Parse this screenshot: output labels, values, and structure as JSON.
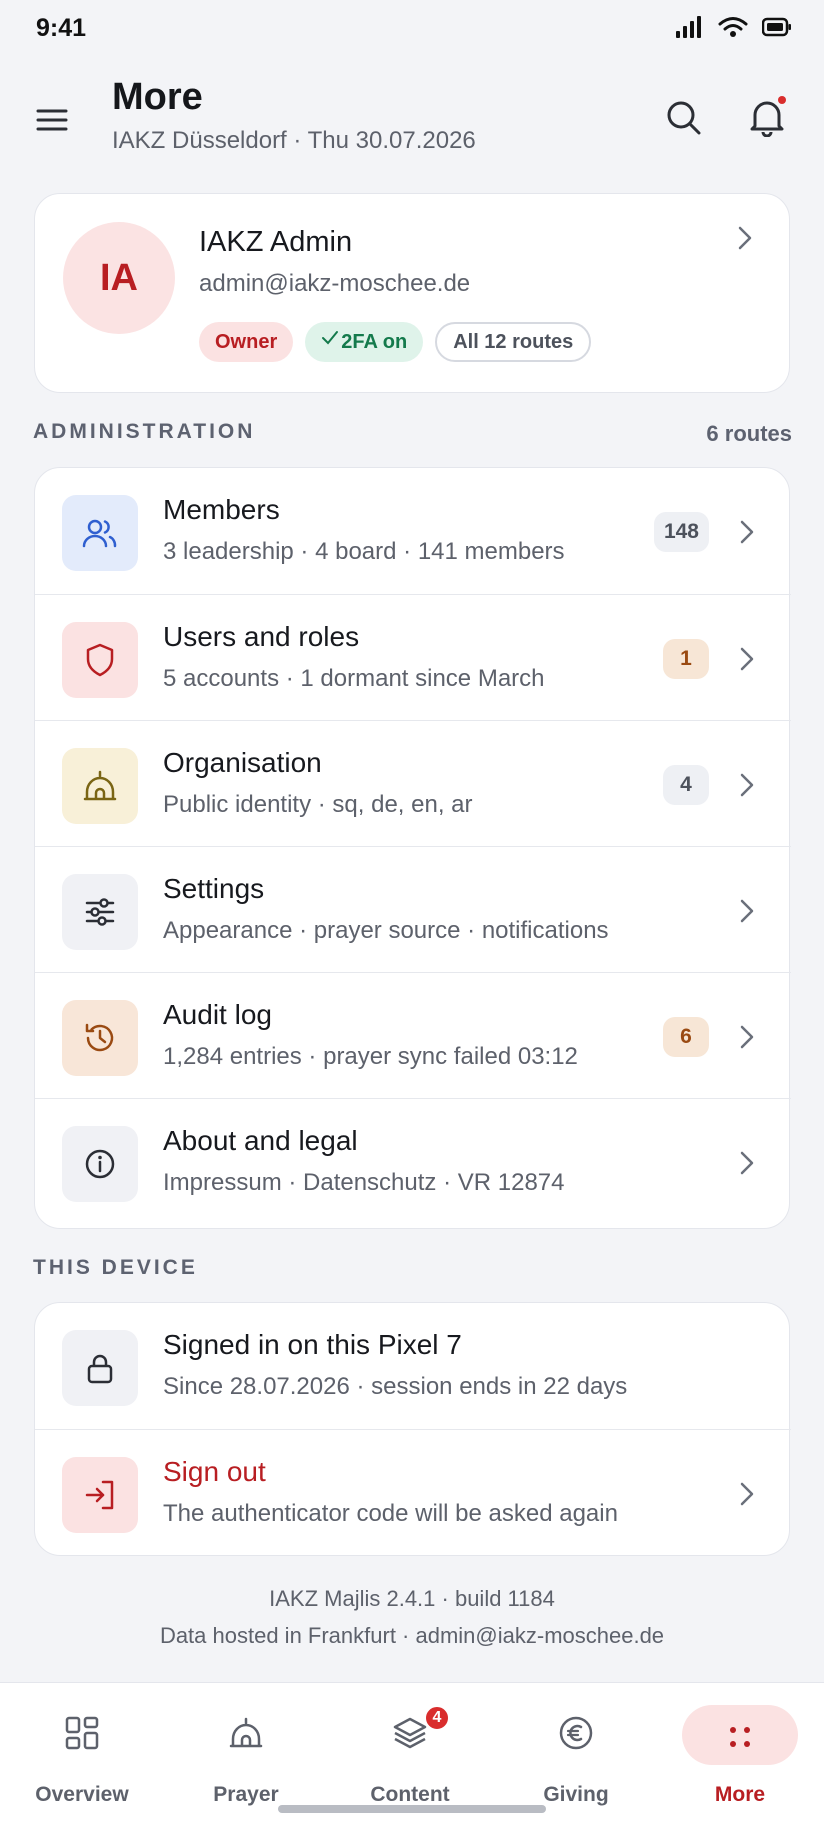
{
  "status": {
    "time": "9:41"
  },
  "header": {
    "title": "More",
    "subtitle": "IAKZ Düsseldorf · Thu 30.07.2026"
  },
  "profile": {
    "initials": "IA",
    "name": "IAKZ Admin",
    "email": "admin@iakz-moschee.de",
    "chips": {
      "owner": "Owner",
      "twofa": "2FA on",
      "routes": "All 12 routes"
    }
  },
  "administration": {
    "label": "ADMINISTRATION",
    "count_label": "6 routes",
    "items": [
      {
        "title": "Members",
        "subtitle": "3 leadership · 4 board · 141 members",
        "count": "148",
        "icon": "people-icon"
      },
      {
        "title": "Users and roles",
        "subtitle": "5 accounts · 1 dormant since March",
        "count": "1",
        "icon": "shield-icon"
      },
      {
        "title": "Organisation",
        "subtitle": "Public identity · sq, de, en, ar",
        "count": "4",
        "icon": "mosque-icon"
      },
      {
        "title": "Settings",
        "subtitle": "Appearance · prayer source · notifications",
        "count": "",
        "icon": "sliders-icon"
      },
      {
        "title": "Audit log",
        "subtitle": "1,284 entries · prayer sync failed 03:12",
        "count": "6",
        "icon": "history-icon"
      },
      {
        "title": "About and legal",
        "subtitle": "Impressum · Datenschutz · VR 12874",
        "count": "",
        "icon": "info-icon"
      }
    ]
  },
  "device": {
    "label": "THIS DEVICE",
    "items": [
      {
        "title": "Signed in on this Pixel 7",
        "subtitle": "Since 28.07.2026 · session ends in 22 days",
        "icon": "lock-icon"
      },
      {
        "title": "Sign out",
        "subtitle": "The authenticator code will be asked again",
        "icon": "sign-out-icon"
      }
    ]
  },
  "footer": {
    "line1": "IAKZ Majlis 2.4.1 · build 1184",
    "line2": "Data hosted in Frankfurt · admin@iakz-moschee.de"
  },
  "nav": {
    "items": [
      {
        "label": "Overview",
        "icon": "grid-icon"
      },
      {
        "label": "Prayer",
        "icon": "mosque-icon"
      },
      {
        "label": "Content",
        "icon": "layers-icon",
        "badge": "4"
      },
      {
        "label": "Giving",
        "icon": "euro-icon"
      },
      {
        "label": "More",
        "icon": "dots-icon",
        "active": true
      }
    ]
  },
  "colors": {
    "accent": "#b81e22",
    "amber": "#9a4a12",
    "success": "#147a4c",
    "background": "#f3f4f7"
  }
}
